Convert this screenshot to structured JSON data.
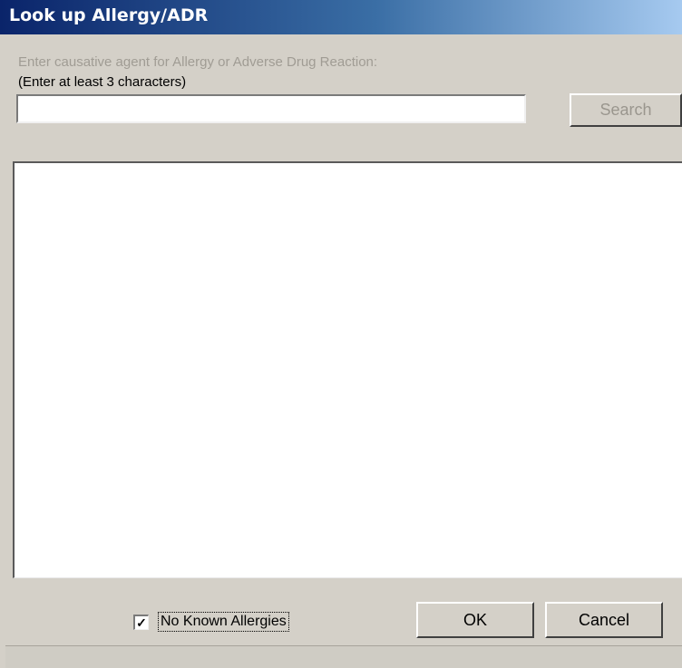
{
  "window": {
    "title": "Look up Allergy/ADR"
  },
  "search": {
    "instruction": "Enter causative agent for Allergy or Adverse Drug Reaction:",
    "hint": "(Enter at least 3 characters)",
    "value": "",
    "button_label": "Search"
  },
  "results": {
    "items": []
  },
  "footer": {
    "nka_label": "No Known Allergies",
    "nka_checked": true,
    "checkmark": "✓",
    "ok_label": "OK",
    "cancel_label": "Cancel"
  },
  "colors": {
    "titlebar_start": "#0a246a",
    "titlebar_end": "#a6caf0",
    "window_bg": "#d4d0c8"
  }
}
